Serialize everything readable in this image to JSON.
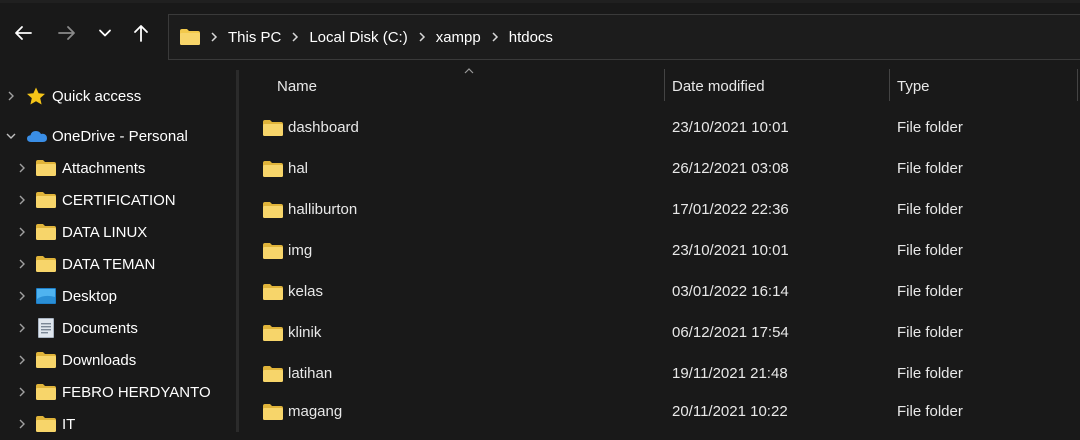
{
  "window": {
    "accent_folder": "#f0c040",
    "background": "#191919"
  },
  "nav": {
    "back_icon": "back-arrow-icon",
    "forward_icon": "forward-arrow-icon",
    "recent_icon": "chevron-down-icon",
    "up_icon": "up-arrow-icon"
  },
  "address": {
    "crumbs": [
      "This PC",
      "Local Disk (C:)",
      "xampp",
      "htdocs"
    ]
  },
  "sidebar": {
    "items": [
      {
        "label": "Quick access",
        "icon": "star-icon",
        "expanded": false
      },
      {
        "label": "OneDrive - Personal",
        "icon": "cloud-icon",
        "expanded": true
      },
      {
        "label": "Attachments",
        "icon": "folder-icon"
      },
      {
        "label": "CERTIFICATION",
        "icon": "folder-icon"
      },
      {
        "label": "DATA LINUX",
        "icon": "folder-icon"
      },
      {
        "label": "DATA TEMAN",
        "icon": "folder-icon"
      },
      {
        "label": "Desktop",
        "icon": "desktop-icon"
      },
      {
        "label": "Documents",
        "icon": "document-icon"
      },
      {
        "label": "Downloads",
        "icon": "folder-icon"
      },
      {
        "label": "FEBRO HERDYANTO",
        "icon": "folder-icon"
      },
      {
        "label": "IT",
        "icon": "folder-icon"
      }
    ]
  },
  "columns": {
    "name": "Name",
    "date": "Date modified",
    "type": "Type"
  },
  "files": [
    {
      "name": "dashboard",
      "date": "23/10/2021 10:01",
      "type": "File folder"
    },
    {
      "name": "hal",
      "date": "26/12/2021 03:08",
      "type": "File folder"
    },
    {
      "name": "halliburton",
      "date": "17/01/2022 22:36",
      "type": "File folder"
    },
    {
      "name": "img",
      "date": "23/10/2021 10:01",
      "type": "File folder"
    },
    {
      "name": "kelas",
      "date": "03/01/2022 16:14",
      "type": "File folder"
    },
    {
      "name": "klinik",
      "date": "06/12/2021 17:54",
      "type": "File folder"
    },
    {
      "name": "latihan",
      "date": "19/11/2021 21:48",
      "type": "File folder"
    },
    {
      "name": "magang",
      "date": "20/11/2021 10:22",
      "type": "File folder"
    }
  ]
}
